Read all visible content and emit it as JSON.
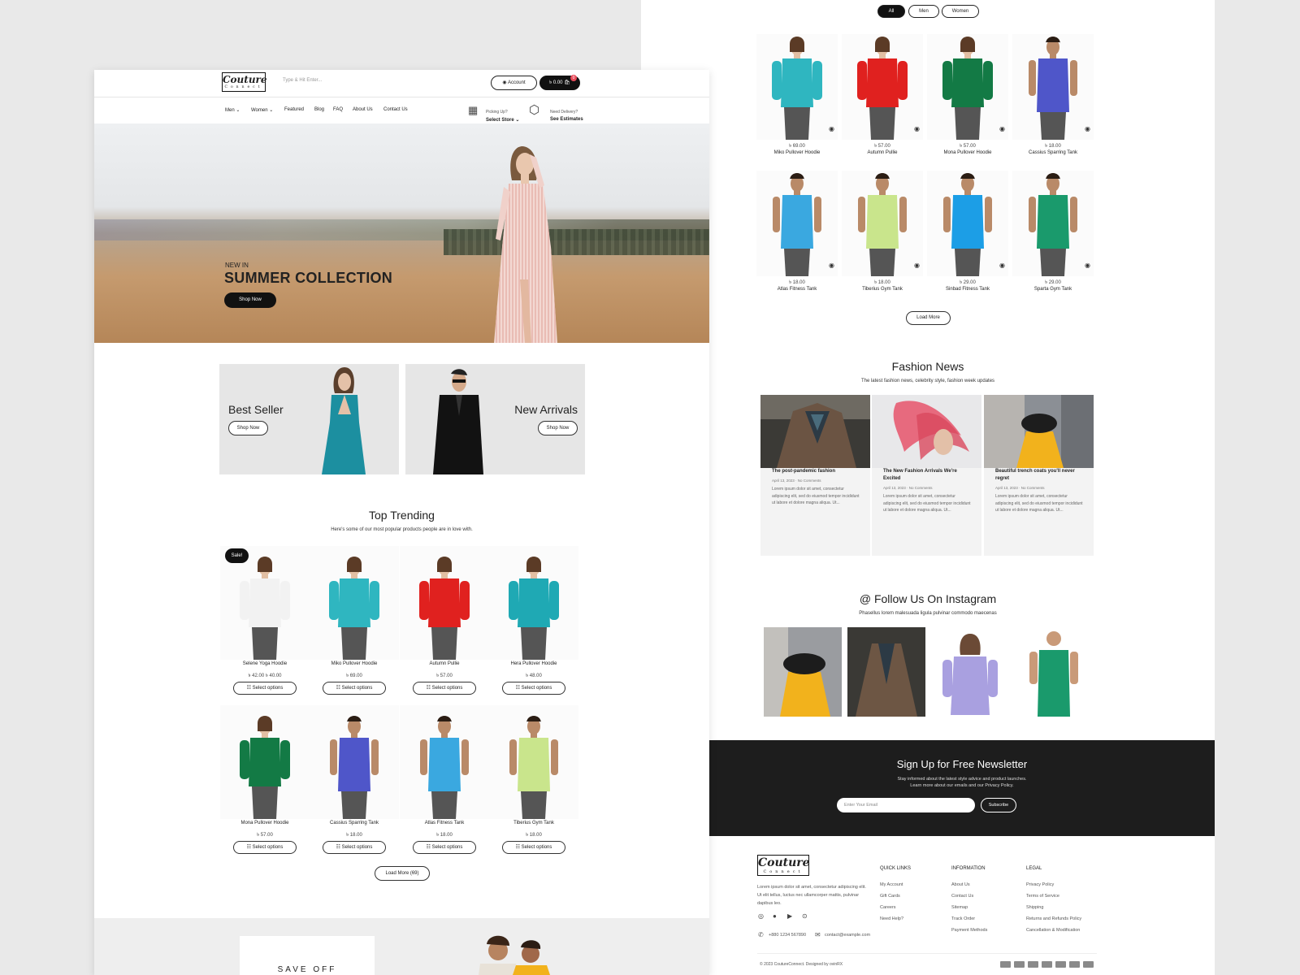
{
  "header": {
    "logo_main": "Couture",
    "logo_sub": "Connect",
    "search_placeholder": "Type & Hit Enter...",
    "account_label": "Account",
    "cart_label": "৳ 0.00",
    "cart_count": "0"
  },
  "nav": {
    "items": [
      "Men",
      "Women",
      "Featured",
      "Blog",
      "FAQ",
      "About Us",
      "Contact Us"
    ],
    "pickup_small": "Picking Up?",
    "pickup_big": "Select Store",
    "delivery_small": "Need Delivery?",
    "delivery_big": "See Estimates"
  },
  "hero": {
    "kicker": "NEW IN",
    "title": "SUMMER COLLECTION",
    "cta": "Shop Now"
  },
  "banners": [
    {
      "title": "Best Seller",
      "cta": "Shop Now"
    },
    {
      "title": "New Arrivals",
      "cta": "Shop Now"
    }
  ],
  "trending": {
    "title": "Top Trending",
    "subtitle": "Here's some of our most popular products people are in love with.",
    "sale_badge": "Sale!",
    "select_label": "Select options",
    "load_more": "Load More (69)",
    "products": [
      {
        "name": "Selene Yoga Hoodie",
        "price": "৳ 42.00  ৳ 40.00",
        "color": "#f2f2f2"
      },
      {
        "name": "Miko Pullover Hoodie",
        "price": "৳ 69.00",
        "color": "#2fb6c0"
      },
      {
        "name": "Autumn Pullie",
        "price": "৳ 57.00",
        "color": "#e0211f"
      },
      {
        "name": "Hera Pullover Hoodie",
        "price": "৳ 48.00",
        "color": "#1fa9b4"
      },
      {
        "name": "Mona Pullover Hoodie",
        "price": "৳ 57.00",
        "color": "#137a45"
      },
      {
        "name": "Cassius Sparring Tank",
        "price": "৳ 18.00",
        "color": "#4f56c9"
      },
      {
        "name": "Atlas Fitness Tank",
        "price": "৳ 18.00",
        "color": "#3aa8e0"
      },
      {
        "name": "Tiberius Gym Tank",
        "price": "৳ 18.00",
        "color": "#c9e58c"
      }
    ]
  },
  "sale_strip": {
    "text": "SAVE OFF"
  },
  "filter_tabs": [
    "All",
    "Men",
    "Women"
  ],
  "grid_products": [
    {
      "name": "Miko Pullover Hoodie",
      "price": "৳ 69.00",
      "color": "#2fb6c0"
    },
    {
      "name": "Autumn Pullie",
      "price": "৳ 57.00",
      "color": "#e0211f"
    },
    {
      "name": "Mona Pullover Hoodie",
      "price": "৳ 57.00",
      "color": "#137a45"
    },
    {
      "name": "Cassius Sparring Tank",
      "price": "৳ 18.00",
      "color": "#4f56c9"
    },
    {
      "name": "Atlas Fitness Tank",
      "price": "৳ 18.00",
      "color": "#3aa8e0"
    },
    {
      "name": "Tiberius Gym Tank",
      "price": "৳ 18.00",
      "color": "#c9e58c"
    },
    {
      "name": "Sinbad Fitness Tank",
      "price": "৳ 29.00",
      "color": "#1c9ee6"
    },
    {
      "name": "Sparta Gym Tank",
      "price": "৳ 29.00",
      "color": "#1a9a6c"
    }
  ],
  "grid_load_more": "Load More",
  "news": {
    "title": "Fashion News",
    "subtitle": "The latest fashion news, celebrity style, fashion week updates",
    "posts": [
      {
        "title": "The post-pandemic fashion",
        "meta": "April 13, 2023 · No Comments",
        "excerpt": "Lorem ipsum dolor sit amet, consectetur adipiscing elit, sed do eiusmod tempor incididunt ut labore et dolore magna aliqua. Ut..."
      },
      {
        "title": "The New Fashion Arrivals We're Excited",
        "meta": "April 13, 2023 · No Comments",
        "excerpt": "Lorem ipsum dolor sit amet, consectetur adipiscing elit, sed do eiusmod tempor incididunt ut labore et dolore magna aliqua. Ut..."
      },
      {
        "title": "Beautiful trench coats you'll never regret",
        "meta": "April 13, 2023 · No Comments",
        "excerpt": "Lorem ipsum dolor sit amet, consectetur adipiscing elit, sed do eiusmod tempor incididunt ut labore et dolore magna aliqua. Ut..."
      }
    ]
  },
  "instagram": {
    "title": "@ Follow Us On Instagram",
    "subtitle": "Phasellus lorem malesuada ligula pulvinar commodo maecenas"
  },
  "newsletter": {
    "title": "Sign Up for Free Newsletter",
    "text1": "Stay informed about the latest style advice and product launches.",
    "text2": "Learn more about our emails and our Privacy Policy.",
    "placeholder": "Enter Your Email",
    "button": "Subscribe"
  },
  "footer": {
    "about": "Lorem ipsum dolor sit amet, consectetur adipiscing elit. Ut elit tellus, luctus nec ullamcorper mattis, pulvinar dapibus leo.",
    "phone": "+880 1234 567890",
    "email": "contact@example.com",
    "quick_links_title": "QUICK LINKS",
    "quick_links": [
      "My Account",
      "Gift Cards",
      "Careers",
      "Need Help?"
    ],
    "information_title": "INFORMATION",
    "information": [
      "About Us",
      "Contact Us",
      "Sitemap",
      "Track Order",
      "Payment Methods"
    ],
    "legal_title": "LEGAL",
    "legal": [
      "Privacy Policy",
      "Terms of Service",
      "Shipping",
      "Returns and Refunds Policy",
      "Cancellation & Modification"
    ],
    "copyright": "© 2023 CoutureConnect. Designed by ovinRX"
  }
}
